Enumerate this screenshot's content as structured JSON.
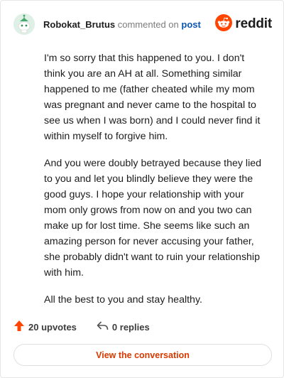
{
  "header": {
    "username": "Robokat_Brutus",
    "action_text": "commented on",
    "post_link": "post",
    "brand": "reddit"
  },
  "comment": {
    "paragraphs": [
      "I'm so sorry that this happened to you. I don't think you are an AH at all. Something similar happened to me (father cheated while my mom was pregnant and never came to the hospital to see us when I was born) and I could never find it within myself to forgive him.",
      "And you were doubly betrayed because they lied to you and let you blindly believe they were the good guys. I hope your relationship with your mom only grows from now on and you two can make up for lost time. She seems like such an amazing person for never accusing your father, she probably didn't want to ruin your relationship with him.",
      "All the best to you and stay healthy."
    ]
  },
  "actions": {
    "upvotes": "20 upvotes",
    "replies": "0 replies",
    "view_conversation": "View the conversation"
  },
  "icons": {
    "avatar": "snoo-avatar-icon",
    "brand": "reddit-logo-icon",
    "upvote": "upvote-arrow-icon",
    "reply": "reply-arrow-icon"
  },
  "colors": {
    "accent": "#ff4500",
    "link": "#0b55b3",
    "button_text": "#d93900"
  }
}
